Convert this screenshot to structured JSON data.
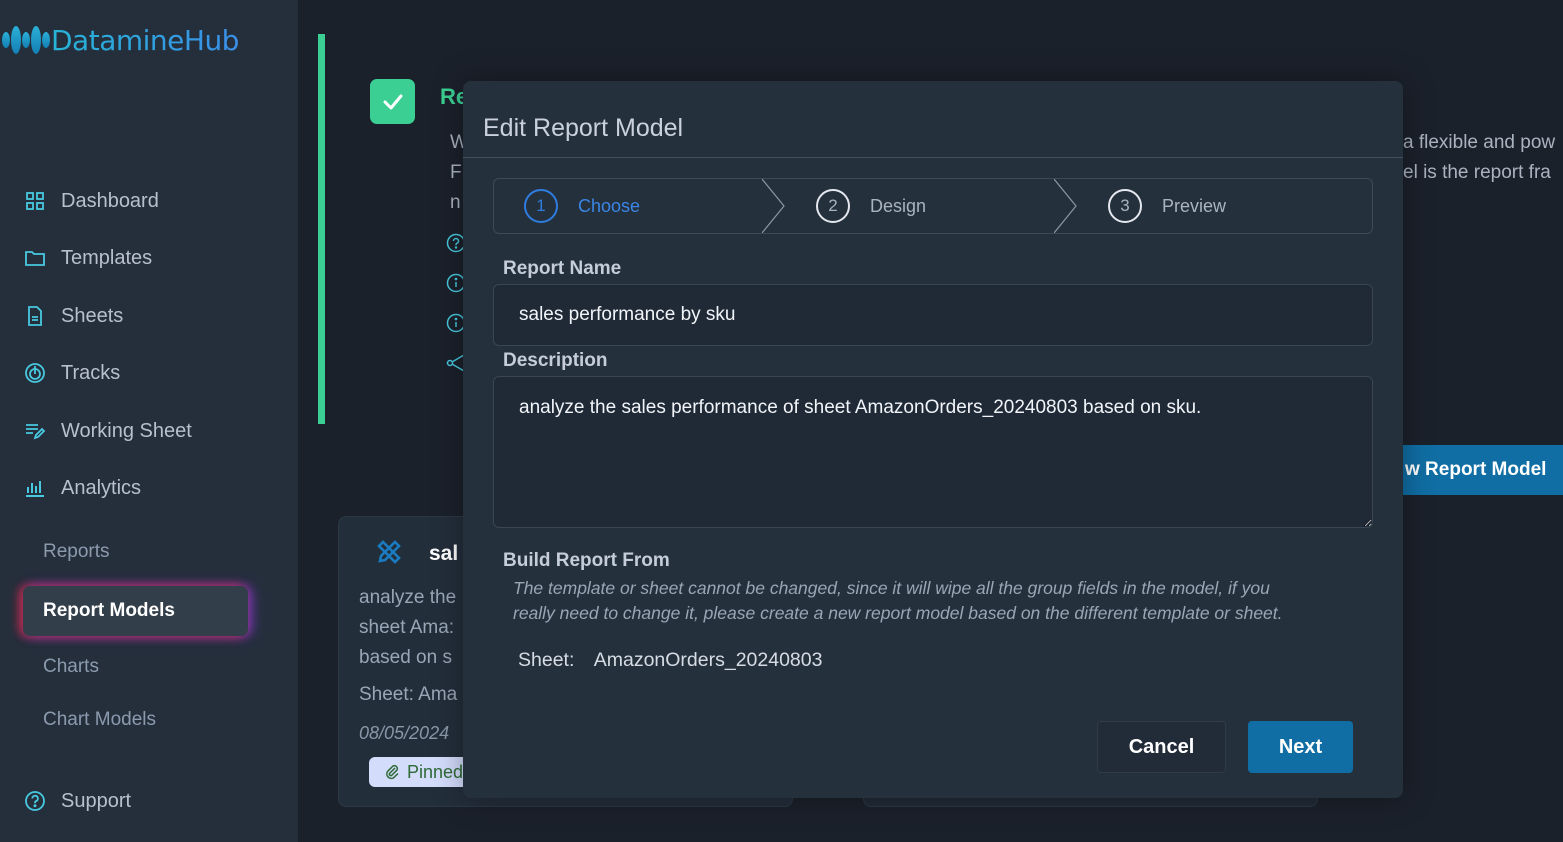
{
  "app": {
    "name": "DatamineHub",
    "colors": {
      "accent": "#106ea4",
      "success": "#3ccf93",
      "step_active": "#2f7de0",
      "icon": "#48c9e0"
    }
  },
  "sidebar": {
    "items": [
      {
        "label": "Dashboard",
        "icon": "grid-icon"
      },
      {
        "label": "Templates",
        "icon": "folder-icon"
      },
      {
        "label": "Sheets",
        "icon": "document-icon"
      },
      {
        "label": "Tracks",
        "icon": "target-icon"
      },
      {
        "label": "Working Sheet",
        "icon": "edit-list-icon"
      },
      {
        "label": "Analytics",
        "icon": "bar-chart-icon"
      }
    ],
    "analytics_sub": [
      {
        "label": "Reports",
        "active": false
      },
      {
        "label": "Report Models",
        "active": true
      },
      {
        "label": "Charts",
        "active": false
      },
      {
        "label": "Chart Models",
        "active": false
      }
    ],
    "support": {
      "label": "Support",
      "icon": "help-circle-icon"
    }
  },
  "background": {
    "banner_title_fragment": "Re",
    "banner_line_fragments": [
      "W",
      "F",
      "n"
    ],
    "right_text_1": "a flexible and pow",
    "right_text_2": "el is the report fra",
    "new_button_fragment": "w Report Model",
    "card": {
      "title_fragment": "sal",
      "desc_lines": [
        "analyze the",
        "sheet Ama:",
        "based on s"
      ],
      "sheet_fragment": "Sheet: Ama",
      "date": "08/05/2024",
      "pinned_fragment": "Pinned"
    }
  },
  "modal": {
    "title": "Edit Report Model",
    "steps": [
      {
        "num": "1",
        "label": "Choose",
        "active": true
      },
      {
        "num": "2",
        "label": "Design",
        "active": false
      },
      {
        "num": "3",
        "label": "Preview",
        "active": false
      }
    ],
    "report_name": {
      "label": "Report Name",
      "value": "sales performance by sku"
    },
    "description": {
      "label": "Description",
      "value": "analyze the sales performance of sheet AmazonOrders_20240803 based on sku."
    },
    "build_from": {
      "label": "Build Report From",
      "hint_line1": "The template or sheet cannot be changed, since it will wipe all the group fields in the model, if you",
      "hint_line2": "really need to change it, please create a new report model based on the different template or sheet.",
      "sheet_key": "Sheet:",
      "sheet_value": "AmazonOrders_20240803"
    },
    "buttons": {
      "cancel": "Cancel",
      "next": "Next"
    }
  }
}
